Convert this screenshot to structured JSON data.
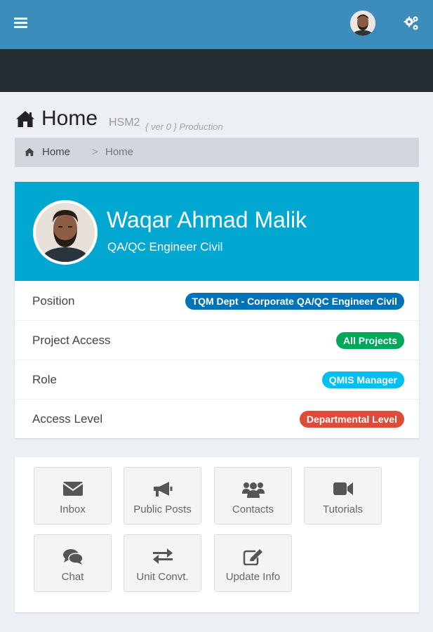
{
  "header": {
    "menu_icon": "hamburger-icon",
    "settings_icon": "gears-icon",
    "colors": {
      "topbar": "#3c8dbc",
      "subbar": "#222d32"
    }
  },
  "page": {
    "title": "Home",
    "app_name": "HSM2",
    "version": "{ ver 0 } Production",
    "title_icon": "home-icon"
  },
  "breadcrumb": {
    "home": "Home",
    "separator": ">",
    "current": "Home"
  },
  "profile": {
    "name": "Waqar Ahmad Malik",
    "designation": "QA/QC Engineer Civil",
    "header_color": "#00a7d0",
    "rows": [
      {
        "label": "Position",
        "badge": "TQM Dept - Corporate QA/QC Engineer Civil",
        "badge_color": "#0073b7"
      },
      {
        "label": "Project Access",
        "badge": "All Projects",
        "badge_color": "#00a65a"
      },
      {
        "label": "Role",
        "badge": "QMIS Manager",
        "badge_color": "#00c0ef"
      },
      {
        "label": "Access Level",
        "badge": "Departmental Level",
        "badge_color": "#dd4b39"
      }
    ]
  },
  "apps": [
    {
      "label": "Inbox",
      "icon": "envelope-icon"
    },
    {
      "label": "Public Posts",
      "icon": "bullhorn-icon"
    },
    {
      "label": "Contacts",
      "icon": "users-icon"
    },
    {
      "label": "Tutorials",
      "icon": "video-camera-icon"
    },
    {
      "label": "Chat",
      "icon": "comments-icon"
    },
    {
      "label": "Unit Convt.",
      "icon": "exchange-icon"
    },
    {
      "label": "Update Info",
      "icon": "edit-icon"
    }
  ]
}
